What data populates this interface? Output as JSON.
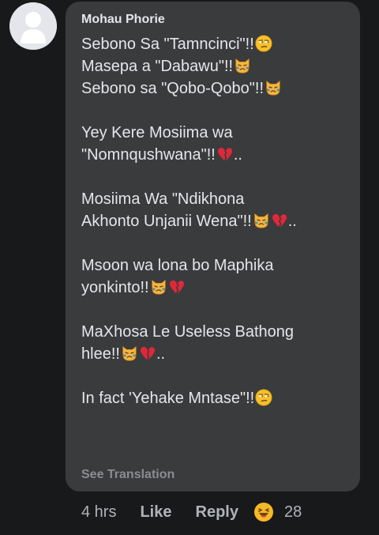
{
  "comment": {
    "author": "Mohau Phorie",
    "paragraphs": [
      [
        {
          "text": "Sebono Sa \"Tamncinci\"!!",
          "emoji": [
            "unamused-face-icon"
          ]
        },
        {
          "text": "Masepa a \"Dabawu\"!!",
          "emoji": [
            "crying-cat-icon"
          ]
        },
        {
          "text": "Sebono sa \"Qobo-Qobo\"!!",
          "emoji": [
            "crying-cat-icon"
          ]
        }
      ],
      [
        {
          "text": "Yey Kere Mosiima wa",
          "emoji": []
        },
        {
          "text": "\"Nomnqushwana\"!!",
          "emoji": [
            "broken-heart-icon"
          ],
          "suffix": ".."
        }
      ],
      [
        {
          "text": "Mosiima Wa \"Ndikhona",
          "emoji": []
        },
        {
          "text": "Akhonto Unjanii Wena\"!!",
          "emoji": [
            "crying-cat-icon",
            "broken-heart-icon"
          ],
          "suffix": ".."
        }
      ],
      [
        {
          "text": "Msoon wa lona bo Maphika",
          "emoji": []
        },
        {
          "text": "yonkinto!!",
          "emoji": [
            "crying-cat-icon",
            "broken-heart-icon"
          ]
        }
      ],
      [
        {
          "text": "MaXhosa Le Useless Bathong",
          "emoji": []
        },
        {
          "text": "hlee!!",
          "emoji": [
            "crying-cat-icon",
            "broken-heart-icon"
          ],
          "suffix": ".."
        }
      ],
      [
        {
          "text": "In fact 'Yehake Mntase\"!!",
          "emoji": [
            "unamused-face-icon"
          ]
        }
      ]
    ],
    "see_translation": "See Translation",
    "time": "4 hrs",
    "like_label": "Like",
    "reply_label": "Reply",
    "reaction_icon": "haha-reaction-icon",
    "reaction_count": "28"
  },
  "colors": {
    "background": "#18191a",
    "bubble": "#3a3b3c",
    "text": "#e4e6eb",
    "secondary": "#b0b3b8"
  }
}
